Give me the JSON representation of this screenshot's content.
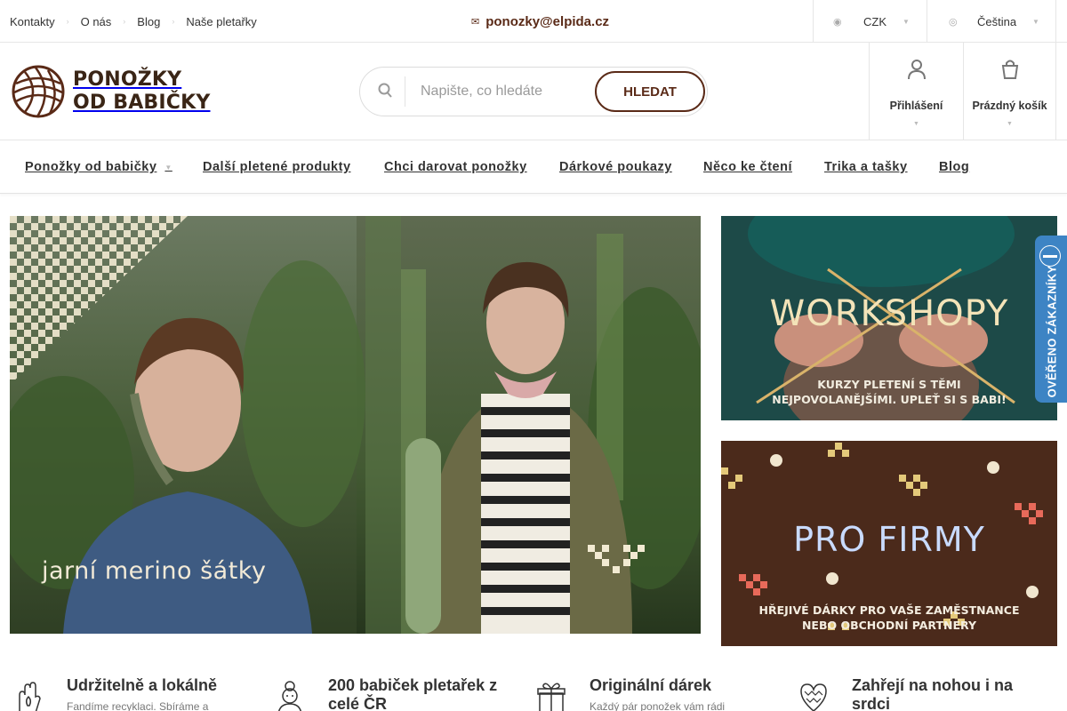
{
  "topbar": {
    "links": [
      "Kontakty",
      "O nás",
      "Blog",
      "Naše pletařky"
    ],
    "email": "ponozky@elpida.cz",
    "currency": "CZK",
    "language": "Čeština"
  },
  "header": {
    "logo_line1": "PONOŽKY",
    "logo_line2": "OD BABIČKY",
    "search_placeholder": "Napište, co hledáte",
    "search_value": "",
    "search_button": "HLEDAT",
    "login_label": "Přihlášení",
    "cart_label": "Prázdný košík"
  },
  "nav": {
    "items": [
      "Ponožky od babičky",
      "Další pletené produkty",
      "Chci darovat ponožky",
      "Dárkové poukazy",
      "Něco ke čtení",
      "Trika a tašky",
      "Blog"
    ]
  },
  "banners": {
    "hero_caption": "jarní merino šátky",
    "workshop_title": "WORKSHOPY",
    "workshop_sub_1": "KURZY PLETENÍ S TĚMI",
    "workshop_sub_2": "NEJPOVOLANĚJŠÍMI. UPLEŤ SI S BABI!",
    "firms_title": "PRO FIRMY",
    "firms_sub_1": "HŘEJIVÉ DÁRKY PRO VAŠE ZAMĚSTNANCE",
    "firms_sub_2": "NEBO OBCHODNÍ PARTNERY"
  },
  "badge": {
    "label": "OVĚŘENO ZÁKAZNÍKY"
  },
  "benefits": [
    {
      "title": "Udržitelně a lokálně",
      "desc": "Fandíme recyklaci. Sbíráme a"
    },
    {
      "title": "200 babiček pletařek z",
      "title2": "celé ČR",
      "desc": ""
    },
    {
      "title": "Originální dárek",
      "desc": "Každý pár ponožek vám rádi"
    },
    {
      "title": "Zahřejí na nohou i na",
      "title2": "srdci",
      "desc": ""
    }
  ],
  "colors": {
    "brand_brown": "#5a2a17",
    "badge_blue": "#3d84c4",
    "workshop_bg": "#1e4746",
    "firms_bg": "#4a2a1a"
  },
  "icons": {
    "email": "envelope-icon",
    "currency": "coins-icon",
    "language": "globe-icon",
    "search": "search-icon",
    "login": "user-icon",
    "cart": "cart-icon",
    "benefit_1": "hand-leaf-icon",
    "benefit_2": "grandma-icon",
    "benefit_3": "gift-icon",
    "benefit_4": "knitted-heart-icon"
  }
}
